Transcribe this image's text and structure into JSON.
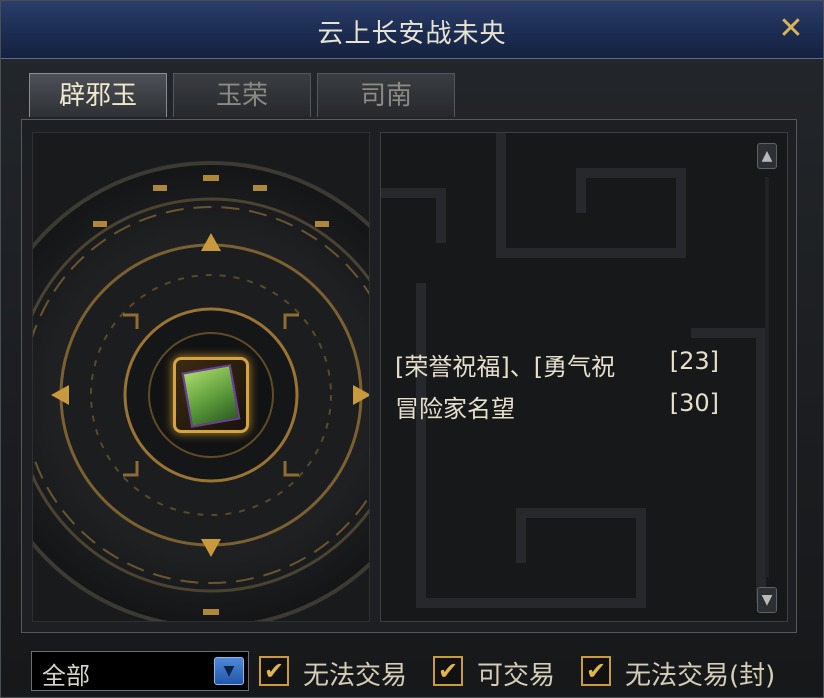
{
  "window": {
    "title": "云上长安战未央",
    "close_glyph": "✕"
  },
  "tabs": [
    {
      "label": "辟邪玉",
      "active": true
    },
    {
      "label": "玉荣",
      "active": false
    },
    {
      "label": "司南",
      "active": false
    }
  ],
  "item_slot": {
    "icon": "green-card-item-icon"
  },
  "rewards": [
    {
      "name": "[荣誉祝福]、[勇气祝",
      "level": "[23]"
    },
    {
      "name": "冒险家名望",
      "level": "[30]"
    }
  ],
  "scroll": {
    "up_glyph": "▲",
    "down_glyph": "▼"
  },
  "footer": {
    "filter": {
      "selected": "全部",
      "arrow_glyph": "▼"
    },
    "checkboxes": [
      {
        "label": "无法交易",
        "checked": true,
        "mark": "✔"
      },
      {
        "label": "可交易",
        "checked": true,
        "mark": "✔"
      },
      {
        "label": "无法交易(封)",
        "checked": true,
        "mark": "✔"
      }
    ]
  },
  "colors": {
    "accent_gold": "#d6a340",
    "titlebar_blue": "#1c2c52",
    "text_light": "#e6dfcb"
  }
}
